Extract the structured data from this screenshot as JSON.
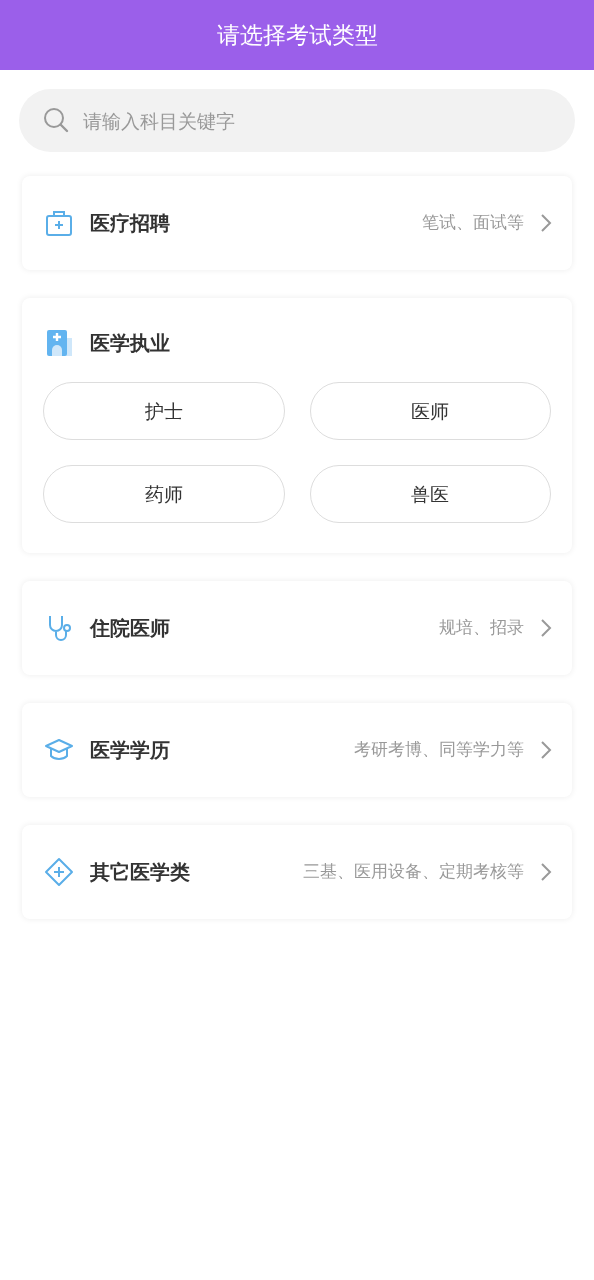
{
  "header": {
    "title": "请选择考试类型"
  },
  "search": {
    "placeholder": "请输入科目关键字"
  },
  "categories": [
    {
      "kind": "link",
      "title": "医疗招聘",
      "hint": "笔试、面试等"
    },
    {
      "kind": "grid",
      "title": "医学执业",
      "options": [
        "护士",
        "医师",
        "药师",
        "兽医"
      ]
    },
    {
      "kind": "link",
      "title": "住院医师",
      "hint": "规培、招录"
    },
    {
      "kind": "link",
      "title": "医学学历",
      "hint": "考研考博、同等学力等"
    },
    {
      "kind": "link",
      "title": "其它医学类",
      "hint": "三基、医用设备、定期考核等"
    }
  ]
}
